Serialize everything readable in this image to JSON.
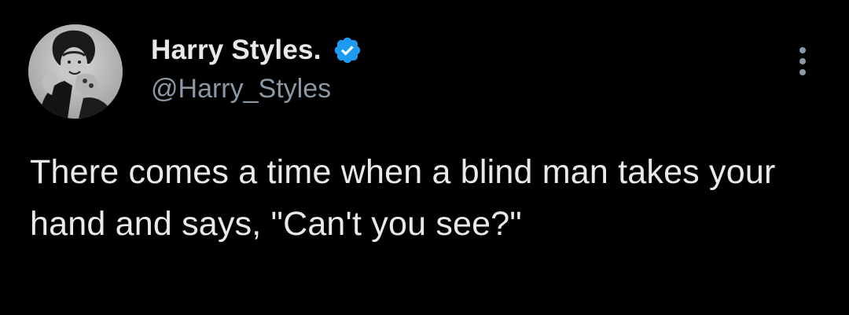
{
  "tweet": {
    "author": {
      "display_name": "Harry Styles.",
      "handle": "@Harry_Styles",
      "verified": true,
      "avatar_icon": "profile-photo-avatar"
    },
    "text": "There comes a time when a blind man takes your hand and says, \"Can't you see?\"",
    "more_icon": "more-options-icon"
  },
  "colors": {
    "background": "#000000",
    "primary_text": "#e7e9ea",
    "secondary_text": "#8b98a5",
    "verified_badge": "#1d9bf0"
  }
}
